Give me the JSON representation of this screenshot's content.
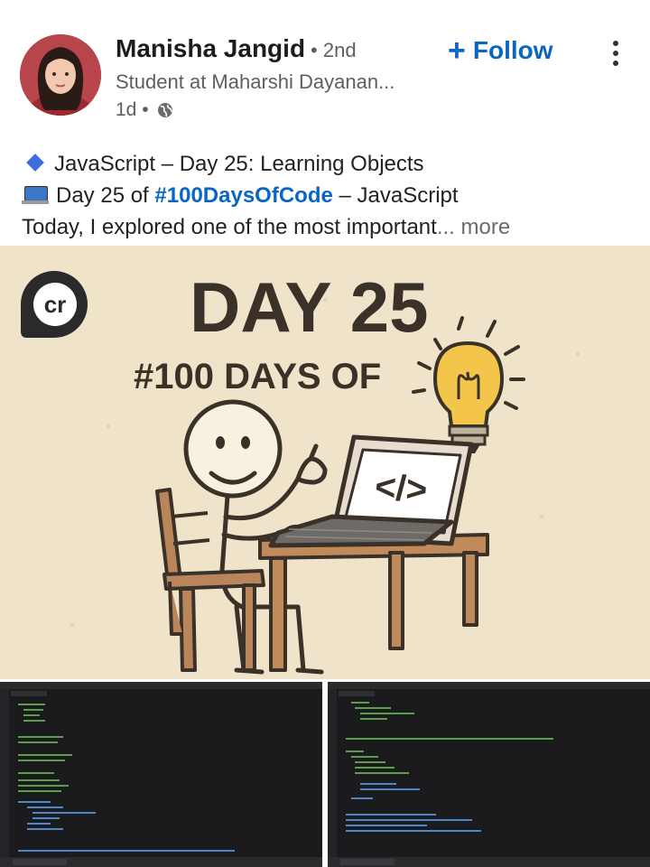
{
  "author": {
    "name": "Manisha Jangid",
    "degree": "• 2nd",
    "headline": "Student at Maharshi Dayanan...",
    "time": "1d •"
  },
  "follow": {
    "label": "Follow"
  },
  "post": {
    "line1": "JavaScript – Day 25: Learning Objects",
    "line2_prefix": "Day 25 of",
    "hashtag": "#100DaysOfCode",
    "line2_suffix": "– JavaScript",
    "line3": "Today, I explored one of the most important",
    "ellipsis": "...",
    "more": "more"
  },
  "image": {
    "day_text": "DAY 25",
    "subtitle": "#100 DAYS OF",
    "code_symbol": "</>",
    "logo": "cr"
  },
  "icons": {
    "globe": "globe-icon",
    "diamond": "blue-diamond-icon",
    "laptop": "laptop-icon",
    "more": "more-vertical-icon",
    "follow": "plus-icon"
  },
  "colors": {
    "link": "#0a66c2",
    "image_bg": "#efe4ca",
    "bulb": "#f3c54a"
  }
}
